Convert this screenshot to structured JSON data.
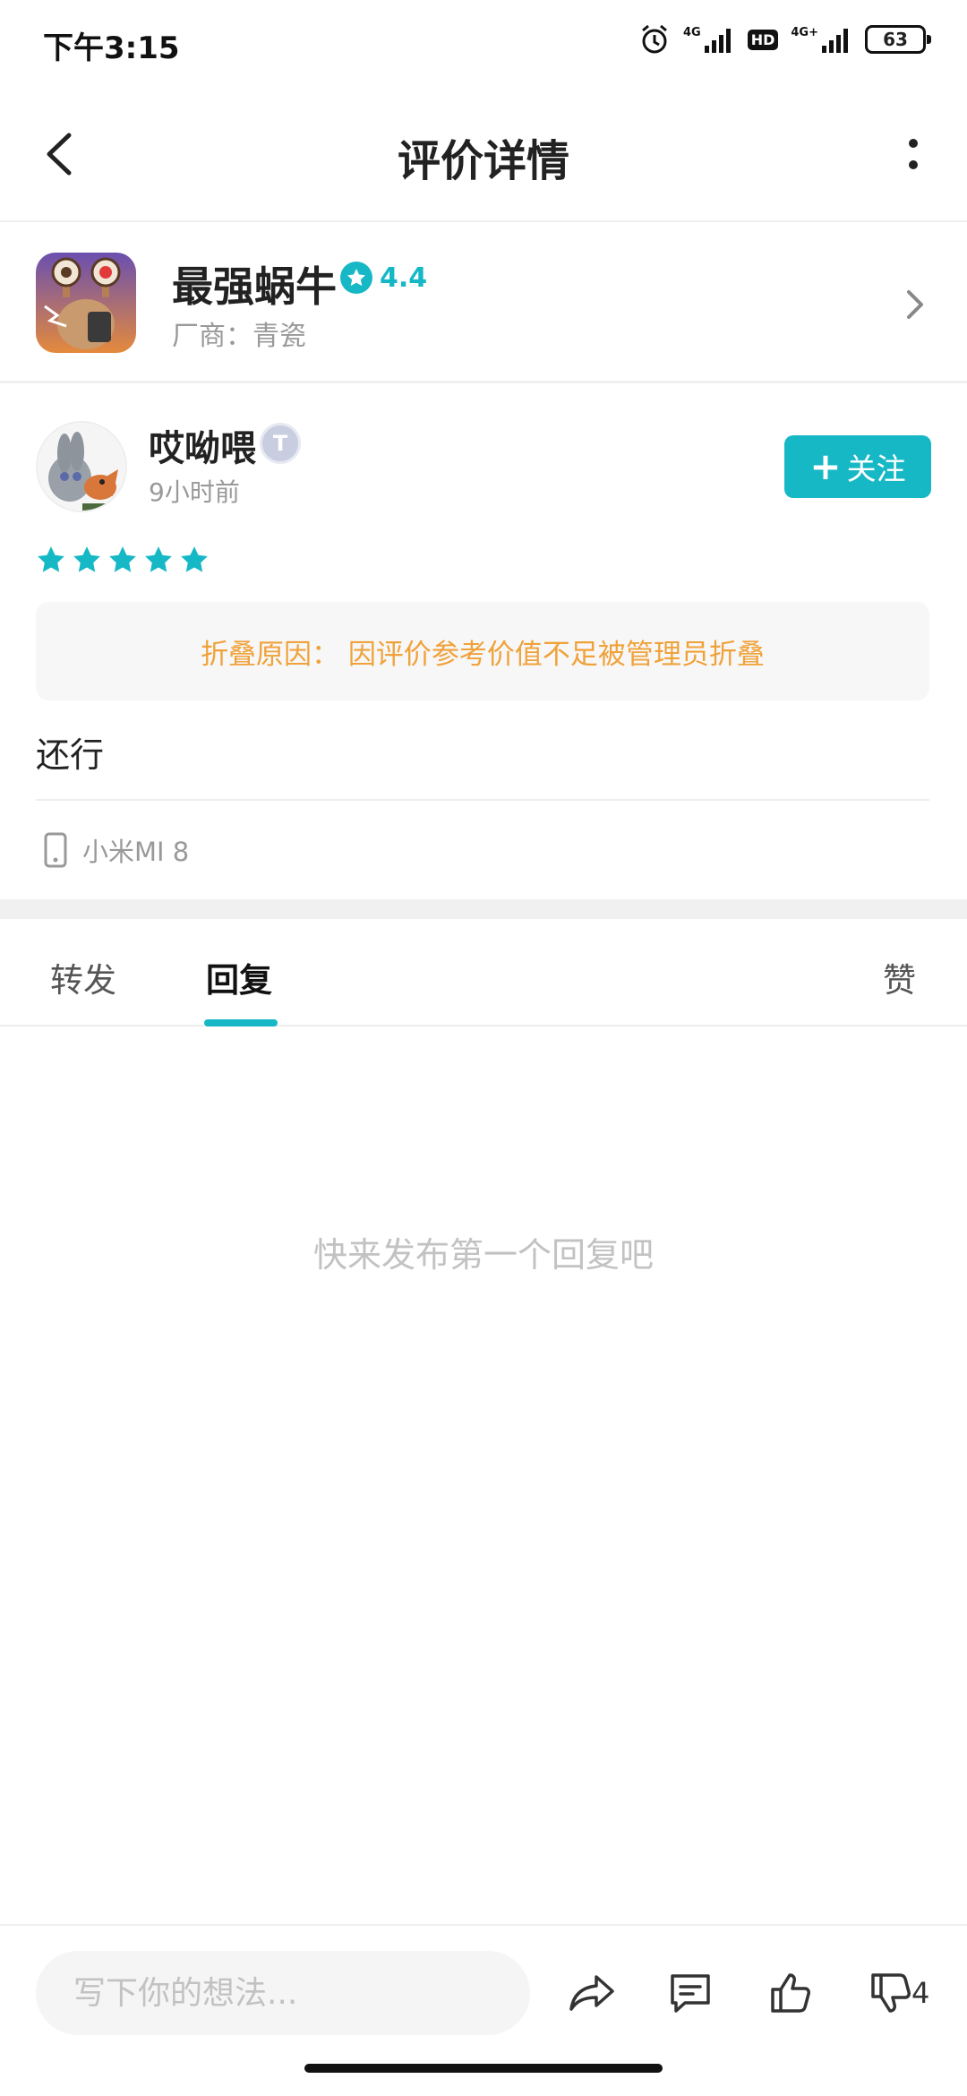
{
  "status_bar": {
    "time": "下午3:15",
    "net1": "4G",
    "hd": "HD",
    "net2": "4G+",
    "battery": "63"
  },
  "header": {
    "title": "评价详情"
  },
  "app": {
    "name": "最强蜗牛",
    "rating": "4.4",
    "vendor": "厂商：青瓷"
  },
  "review": {
    "author": "哎呦喂",
    "level_badge": "T",
    "time": "9小时前",
    "follow_label": "关注",
    "stars": 5,
    "fold_notice": "折叠原因： 因评价参考价值不足被管理员折叠",
    "content": "还行",
    "device": "小米MI 8"
  },
  "tabs": [
    {
      "label": "转发",
      "active": false
    },
    {
      "label": "回复",
      "active": true
    },
    {
      "label": "赞",
      "active": false
    }
  ],
  "empty_state": "快来发布第一个回复吧",
  "bottom_bar": {
    "input_placeholder": "写下你的想法...",
    "dislike_count": "4"
  },
  "colors": {
    "accent": "#16b8c6",
    "warning_text": "#f0a23a"
  }
}
